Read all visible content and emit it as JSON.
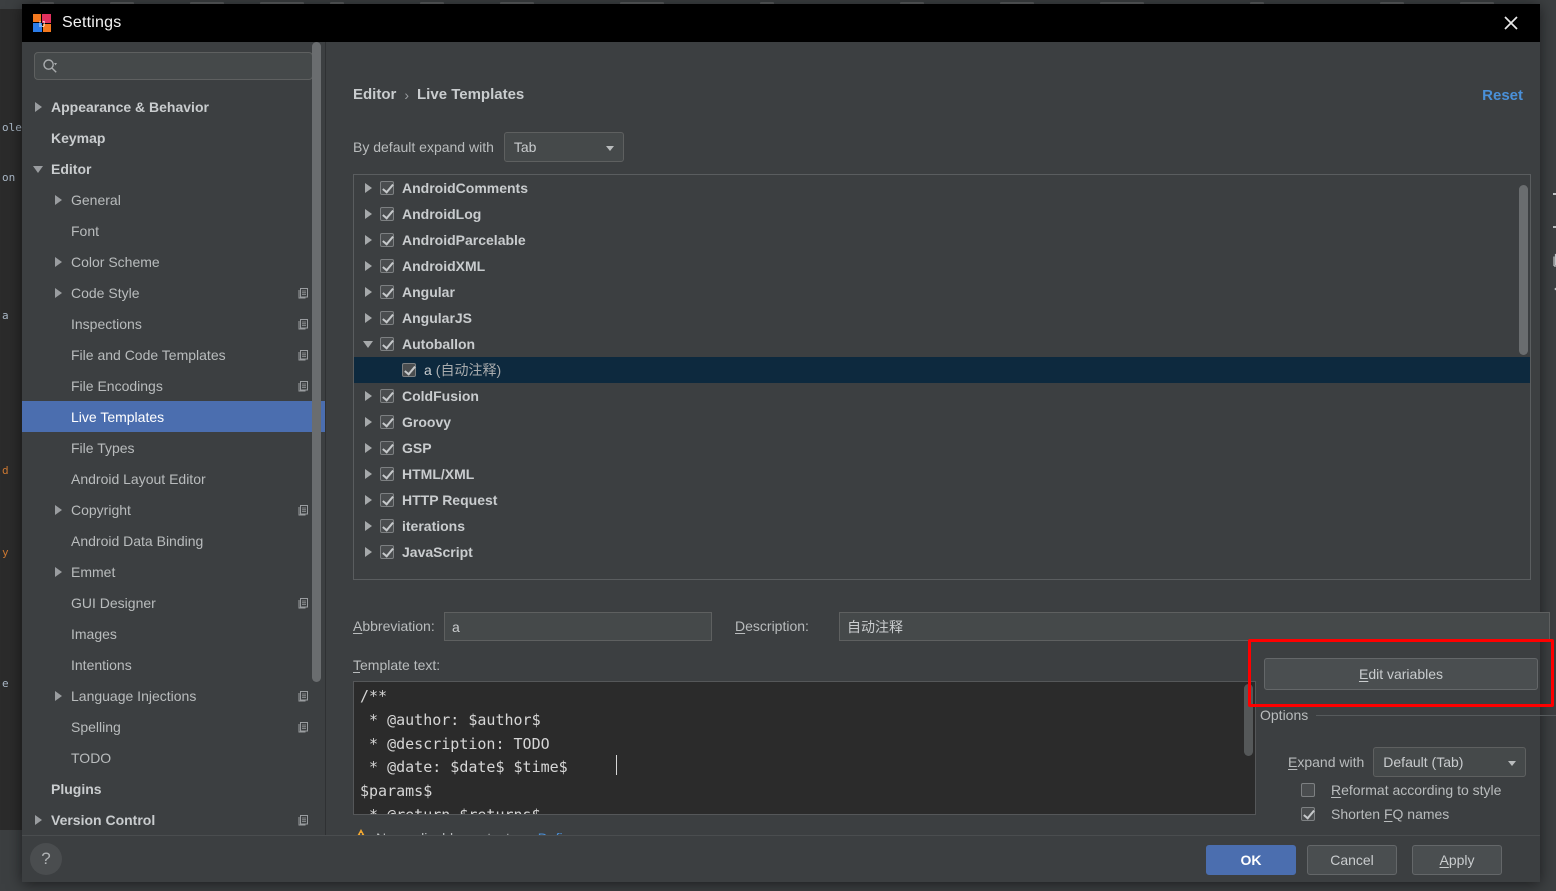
{
  "window": {
    "title": "Settings",
    "logo_icon": "intellij-idea-logo-icon",
    "close_icon": "close-icon"
  },
  "sidebar": {
    "search": {
      "value": "",
      "placeholder": "",
      "icon": "search-icon"
    },
    "items": [
      {
        "label": "Appearance & Behavior",
        "arrow": "closed",
        "indent": 0,
        "bold": true,
        "badge": false,
        "selected": false
      },
      {
        "label": "Keymap",
        "arrow": "none",
        "indent": 0,
        "bold": true,
        "badge": false,
        "selected": false
      },
      {
        "label": "Editor",
        "arrow": "open",
        "indent": 0,
        "bold": true,
        "badge": false,
        "selected": false
      },
      {
        "label": "General",
        "arrow": "closed",
        "indent": 1,
        "bold": false,
        "badge": false,
        "selected": false
      },
      {
        "label": "Font",
        "arrow": "none",
        "indent": 1,
        "bold": false,
        "badge": false,
        "selected": false
      },
      {
        "label": "Color Scheme",
        "arrow": "closed",
        "indent": 1,
        "bold": false,
        "badge": false,
        "selected": false
      },
      {
        "label": "Code Style",
        "arrow": "closed",
        "indent": 1,
        "bold": false,
        "badge": true,
        "selected": false
      },
      {
        "label": "Inspections",
        "arrow": "none",
        "indent": 1,
        "bold": false,
        "badge": true,
        "selected": false
      },
      {
        "label": "File and Code Templates",
        "arrow": "none",
        "indent": 1,
        "bold": false,
        "badge": true,
        "selected": false
      },
      {
        "label": "File Encodings",
        "arrow": "none",
        "indent": 1,
        "bold": false,
        "badge": true,
        "selected": false
      },
      {
        "label": "Live Templates",
        "arrow": "none",
        "indent": 1,
        "bold": false,
        "badge": false,
        "selected": true
      },
      {
        "label": "File Types",
        "arrow": "none",
        "indent": 1,
        "bold": false,
        "badge": false,
        "selected": false
      },
      {
        "label": "Android Layout Editor",
        "arrow": "none",
        "indent": 1,
        "bold": false,
        "badge": false,
        "selected": false
      },
      {
        "label": "Copyright",
        "arrow": "closed",
        "indent": 1,
        "bold": false,
        "badge": true,
        "selected": false
      },
      {
        "label": "Android Data Binding",
        "arrow": "none",
        "indent": 1,
        "bold": false,
        "badge": false,
        "selected": false
      },
      {
        "label": "Emmet",
        "arrow": "closed",
        "indent": 1,
        "bold": false,
        "badge": false,
        "selected": false
      },
      {
        "label": "GUI Designer",
        "arrow": "none",
        "indent": 1,
        "bold": false,
        "badge": true,
        "selected": false
      },
      {
        "label": "Images",
        "arrow": "none",
        "indent": 1,
        "bold": false,
        "badge": false,
        "selected": false
      },
      {
        "label": "Intentions",
        "arrow": "none",
        "indent": 1,
        "bold": false,
        "badge": false,
        "selected": false
      },
      {
        "label": "Language Injections",
        "arrow": "closed",
        "indent": 1,
        "bold": false,
        "badge": true,
        "selected": false
      },
      {
        "label": "Spelling",
        "arrow": "none",
        "indent": 1,
        "bold": false,
        "badge": true,
        "selected": false
      },
      {
        "label": "TODO",
        "arrow": "none",
        "indent": 1,
        "bold": false,
        "badge": false,
        "selected": false
      },
      {
        "label": "Plugins",
        "arrow": "none",
        "indent": 0,
        "bold": true,
        "badge": false,
        "selected": false
      },
      {
        "label": "Version Control",
        "arrow": "closed",
        "indent": 0,
        "bold": true,
        "badge": true,
        "selected": false
      }
    ]
  },
  "content": {
    "breadcrumb": {
      "root": "Editor",
      "separator": "›",
      "leaf": "Live Templates"
    },
    "reset_label": "Reset",
    "expand_row": {
      "label": "By default expand with",
      "value": "Tab"
    },
    "templates": [
      {
        "label": "AndroidComments",
        "arrow": "closed",
        "checked": true,
        "child": false,
        "selected": false,
        "sub": ""
      },
      {
        "label": "AndroidLog",
        "arrow": "closed",
        "checked": true,
        "child": false,
        "selected": false,
        "sub": ""
      },
      {
        "label": "AndroidParcelable",
        "arrow": "closed",
        "checked": true,
        "child": false,
        "selected": false,
        "sub": ""
      },
      {
        "label": "AndroidXML",
        "arrow": "closed",
        "checked": true,
        "child": false,
        "selected": false,
        "sub": ""
      },
      {
        "label": "Angular",
        "arrow": "closed",
        "checked": true,
        "child": false,
        "selected": false,
        "sub": ""
      },
      {
        "label": "AngularJS",
        "arrow": "closed",
        "checked": true,
        "child": false,
        "selected": false,
        "sub": ""
      },
      {
        "label": "Autoballon",
        "arrow": "open",
        "checked": true,
        "child": false,
        "selected": false,
        "sub": ""
      },
      {
        "label": "a",
        "arrow": "none",
        "checked": true,
        "child": true,
        "selected": true,
        "sub": "(自动注释)"
      },
      {
        "label": "ColdFusion",
        "arrow": "closed",
        "checked": true,
        "child": false,
        "selected": false,
        "sub": ""
      },
      {
        "label": "Groovy",
        "arrow": "closed",
        "checked": true,
        "child": false,
        "selected": false,
        "sub": ""
      },
      {
        "label": "GSP",
        "arrow": "closed",
        "checked": true,
        "child": false,
        "selected": false,
        "sub": ""
      },
      {
        "label": "HTML/XML",
        "arrow": "closed",
        "checked": true,
        "child": false,
        "selected": false,
        "sub": ""
      },
      {
        "label": "HTTP Request",
        "arrow": "closed",
        "checked": true,
        "child": false,
        "selected": false,
        "sub": ""
      },
      {
        "label": "iterations",
        "arrow": "closed",
        "checked": true,
        "child": false,
        "selected": false,
        "sub": ""
      },
      {
        "label": "JavaScript",
        "arrow": "closed",
        "checked": true,
        "child": false,
        "selected": false,
        "sub": ""
      }
    ],
    "list_toolbar": [
      {
        "icon": "plus-icon",
        "name": "add-template-button"
      },
      {
        "icon": "minus-icon",
        "name": "remove-template-button"
      },
      {
        "icon": "copy-icon",
        "name": "duplicate-template-button"
      },
      {
        "icon": "revert-icon",
        "name": "restore-defaults-button"
      }
    ],
    "abbreviation": {
      "label": "Abbreviation:",
      "value": "a"
    },
    "description": {
      "label": "Description:",
      "value": "自动注释"
    },
    "template_text": {
      "label": "Template text:",
      "value": "/**\n * @author: $author$\n * @description: TODO\n * @date: $date$ $time$\n$params$\n * @return $returns$"
    },
    "context_warning": {
      "icon": "warning-icon",
      "text": "No applicable contexts.",
      "define_label": "Define",
      "define_caret": "∨"
    },
    "edit_variables_label": "Edit variables",
    "options": {
      "legend": "Options",
      "expand_with": {
        "label": "Expand with",
        "value": "Default (Tab)"
      },
      "reformat": {
        "label": "Reformat according to style",
        "checked": false
      },
      "shorten": {
        "label": "Shorten FQ names",
        "checked": true
      }
    },
    "highlight_color": "#ff0000"
  },
  "footer": {
    "help_icon": "help-icon",
    "help_glyph": "?",
    "ok": "OK",
    "cancel": "Cancel",
    "apply": "Apply"
  }
}
